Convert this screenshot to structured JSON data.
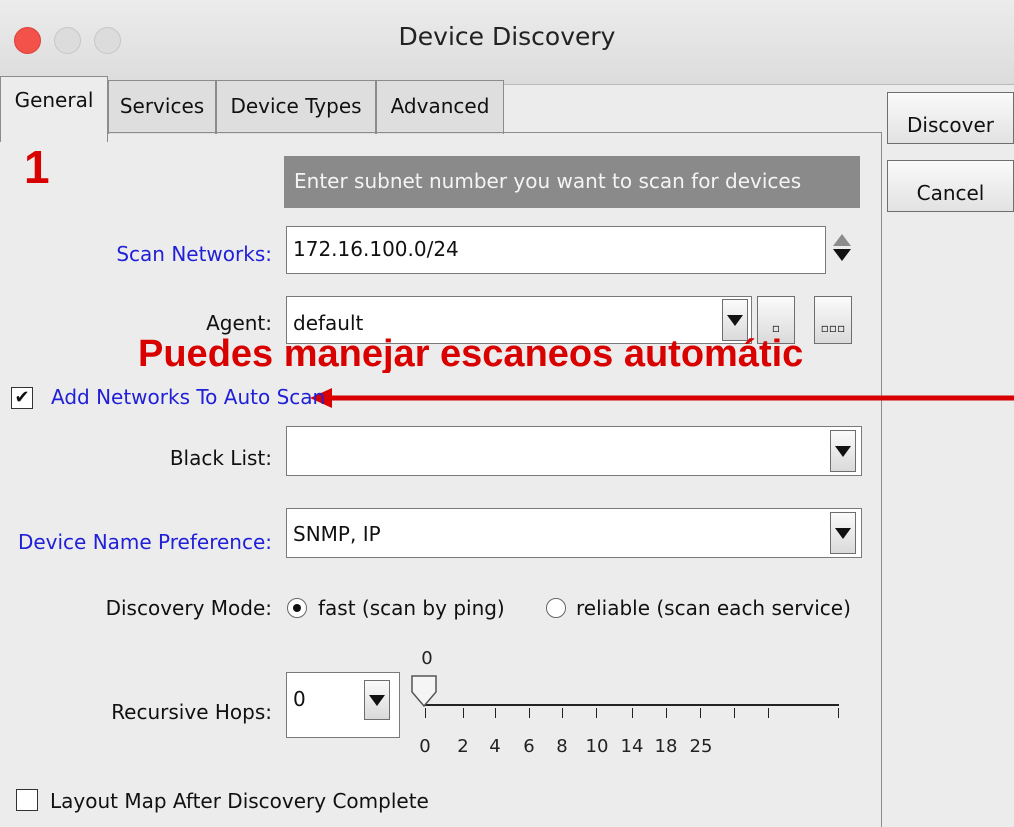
{
  "window": {
    "title": "Device Discovery"
  },
  "tabs": [
    {
      "label": "General",
      "active": true
    },
    {
      "label": "Services",
      "active": false
    },
    {
      "label": "Device Types",
      "active": false
    },
    {
      "label": "Advanced",
      "active": false
    }
  ],
  "buttons": {
    "discover": "Discover",
    "cancel": "Cancel"
  },
  "step_number": "1",
  "hint": "Enter subnet number you want to scan for devices",
  "scan_networks": {
    "label": "Scan Networks:",
    "value": "172.16.100.0/24"
  },
  "agent": {
    "label": "Agent:",
    "value": "default",
    "edit_button": "▫",
    "more_button": "▫▫▫"
  },
  "annotation": "Puedes manejar escaneos automátic",
  "add_networks": {
    "label": "Add Networks To Auto Scan",
    "checked": true,
    "check_glyph": "✔"
  },
  "black_list": {
    "label": "Black List:",
    "value": ""
  },
  "device_name_preference": {
    "label": "Device Name Preference:",
    "value": "SNMP, IP"
  },
  "discovery_mode": {
    "label": "Discovery Mode:",
    "options": [
      {
        "label": "fast (scan by ping)",
        "selected": true
      },
      {
        "label": "reliable (scan each service)",
        "selected": false
      }
    ]
  },
  "recursive_hops": {
    "label": "Recursive Hops:",
    "value": "0",
    "slider_value": "0",
    "slider_ticks": [
      "0",
      "2",
      "4",
      "6",
      "8",
      "10",
      "14",
      "18",
      "25"
    ]
  },
  "layout_map": {
    "label": "Layout Map After Discovery Complete",
    "checked": false
  },
  "colors": {
    "accent_red": "#d90000",
    "link_blue": "#2020d8",
    "close_button": "#f2524a"
  }
}
